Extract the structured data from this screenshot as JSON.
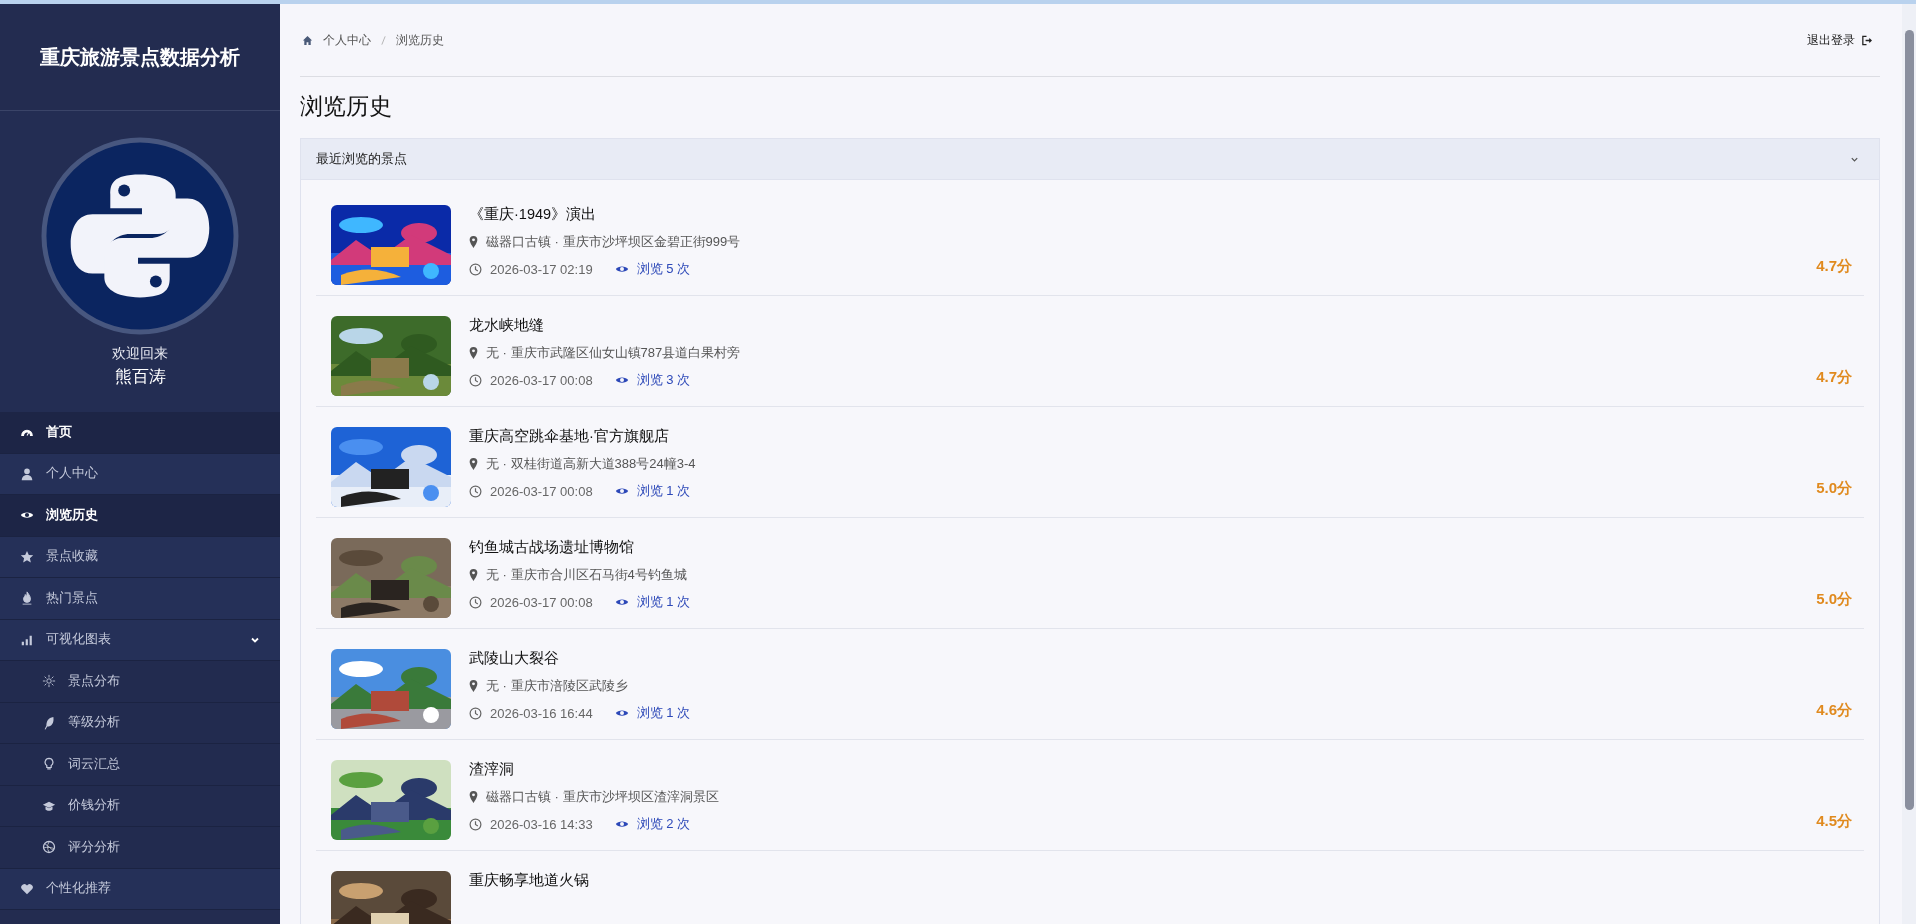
{
  "sidebar": {
    "title": "重庆旅游景点数据分析",
    "welcome": "欢迎回来",
    "username": "熊百涛",
    "items": [
      {
        "label": "首页",
        "kind": "gauge",
        "selected": true
      },
      {
        "label": "个人中心",
        "kind": "user",
        "selected": false
      },
      {
        "label": "浏览历史",
        "kind": "eye",
        "selected": true
      },
      {
        "label": "景点收藏",
        "kind": "star",
        "selected": false
      },
      {
        "label": "热门景点",
        "kind": "fire",
        "selected": false
      },
      {
        "label": "可视化图表",
        "kind": "chart",
        "selected": false,
        "expanded": true,
        "children": [
          {
            "label": "景点分布",
            "kind": "sun",
            "selected": false
          },
          {
            "label": "等级分析",
            "kind": "feather",
            "selected": false
          },
          {
            "label": "词云汇总",
            "kind": "bulb",
            "selected": false
          },
          {
            "label": "价钱分析",
            "kind": "cap",
            "selected": false
          },
          {
            "label": "评分分析",
            "kind": "ball",
            "selected": false
          }
        ]
      },
      {
        "label": "个性化推荐",
        "kind": "heart",
        "selected": false
      }
    ]
  },
  "breadcrumb": [
    "个人中心",
    "浏览历史"
  ],
  "logout": "退出登录",
  "page_title": "浏览历史",
  "panel": {
    "title": "最近浏览的景点",
    "expanded": true,
    "items": [
      {
        "name": "《重庆·1949》演出",
        "location": "磁器口古镇 · 重庆市沙坪坝区金碧正街999号",
        "time": "2026-03-17 02:19",
        "views": "浏览 5 次",
        "score": "4.7分"
      },
      {
        "name": "龙水峡地缝",
        "location": "无 · 重庆市武隆区仙女山镇787县道白果村旁",
        "time": "2026-03-17 00:08",
        "views": "浏览 3 次",
        "score": "4.7分"
      },
      {
        "name": "重庆高空跳伞基地·官方旗舰店",
        "location": "无 · 双桂街道高新大道388号24幢3-4",
        "time": "2026-03-17 00:08",
        "views": "浏览 1 次",
        "score": "5.0分"
      },
      {
        "name": "钓鱼城古战场遗址博物馆",
        "location": "无 · 重庆市合川区石马街4号钓鱼城",
        "time": "2026-03-17 00:08",
        "views": "浏览 1 次",
        "score": "5.0分"
      },
      {
        "name": "武陵山大裂谷",
        "location": "无 · 重庆市涪陵区武陵乡",
        "time": "2026-03-16 16:44",
        "views": "浏览 1 次",
        "score": "4.6分"
      },
      {
        "name": "渣滓洞",
        "location": "磁器口古镇 · 重庆市沙坪坝区渣滓洞景区",
        "time": "2026-03-16 14:33",
        "views": "浏览 2 次",
        "score": "4.5分"
      },
      {
        "name": "重庆畅享地道火锅"
      }
    ]
  }
}
